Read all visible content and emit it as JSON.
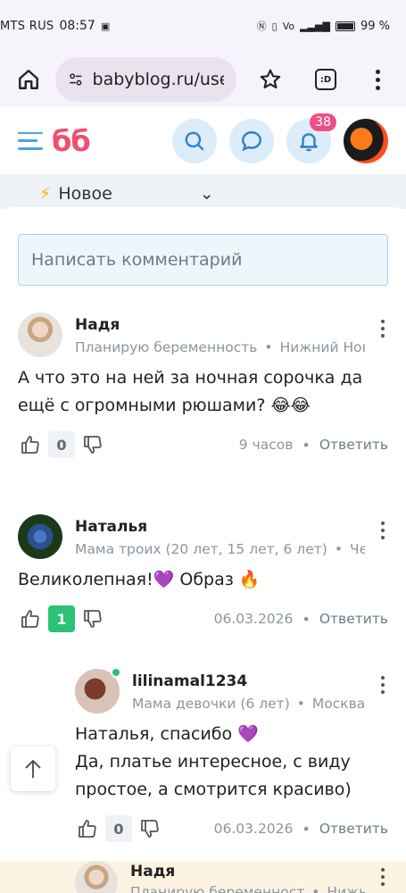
{
  "status_bar": {
    "carrier": "MTS RUS",
    "time": "08:57",
    "battery": "99 %"
  },
  "browser": {
    "url": "babyblog.ru/user/"
  },
  "header": {
    "logo": "бб",
    "notifications_count": "38"
  },
  "sort": {
    "label": "Новое"
  },
  "comment_input": {
    "placeholder": "Написать комментарий"
  },
  "comments": [
    {
      "author": "Надя",
      "status": "Планирую беременность",
      "location": "Нижний Новгор",
      "text": "А что это на ней за ночная сорочка да ещё с огромными рюшами? 😂😂",
      "votes": "0",
      "date": "9 часов",
      "reply_label": "Ответить"
    },
    {
      "author": "Наталья",
      "status": "Мама троих (20 лет, 15 лет, 6 лет)",
      "location": "Челяби",
      "text": "Великолепная!💜 Образ 🔥",
      "votes": "1",
      "date": "06.03.2026",
      "reply_label": "Ответить"
    },
    {
      "author": "lilinamal1234",
      "status": "Мама девочки (6 лет)",
      "location": "Москва",
      "text_line1": "Наталья, спасибо 💜",
      "text_line2": "Да, платье интересное, с виду простое, а смотрится красиво)",
      "votes": "0",
      "date": "06.03.2026",
      "reply_label": "Ответить"
    },
    {
      "author": "Надя",
      "status": "Планирую беременност",
      "location": "Нижни"
    }
  ]
}
